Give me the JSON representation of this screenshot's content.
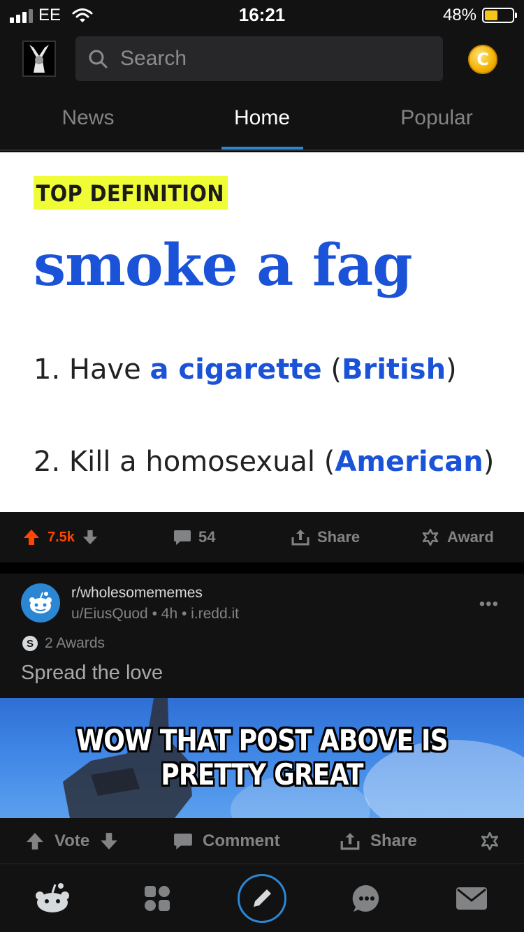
{
  "status_bar": {
    "carrier": "EE",
    "time": "16:21",
    "battery": "48%",
    "battery_level": 0.48
  },
  "header": {
    "search_placeholder": "Search",
    "coin_letter": "C"
  },
  "tabs": [
    {
      "label": "News",
      "active": false
    },
    {
      "label": "Home",
      "active": true
    },
    {
      "label": "Popular",
      "active": false
    }
  ],
  "post1": {
    "image": {
      "badge": "TOP DEFINITION",
      "word": "smoke a fag",
      "def1": {
        "num": "1. Have ",
        "link1": "a cigarette",
        "mid": " (",
        "link2": "British",
        "end": ")"
      },
      "def2": {
        "num": "2. Kill a homosexual (",
        "link": "American",
        "end": ")"
      }
    },
    "votes": "7.5k",
    "comments": "54",
    "share_label": "Share",
    "award_label": "Award"
  },
  "post2": {
    "subreddit": "r/wholesomememes",
    "meta": "u/EiusQuod • 4h • i.redd.it",
    "awards_label": "2 Awards",
    "title": "Spread the love",
    "meme_text": "WOW THAT POST ABOVE IS PRETTY GREAT",
    "vote_label": "Vote",
    "comment_label": "Comment",
    "share_label": "Share"
  },
  "colors": {
    "accent": "#2b87d3",
    "upvote": "#ff4500",
    "definition_blue": "#1a52d8",
    "highlight": "#f0fc35"
  }
}
